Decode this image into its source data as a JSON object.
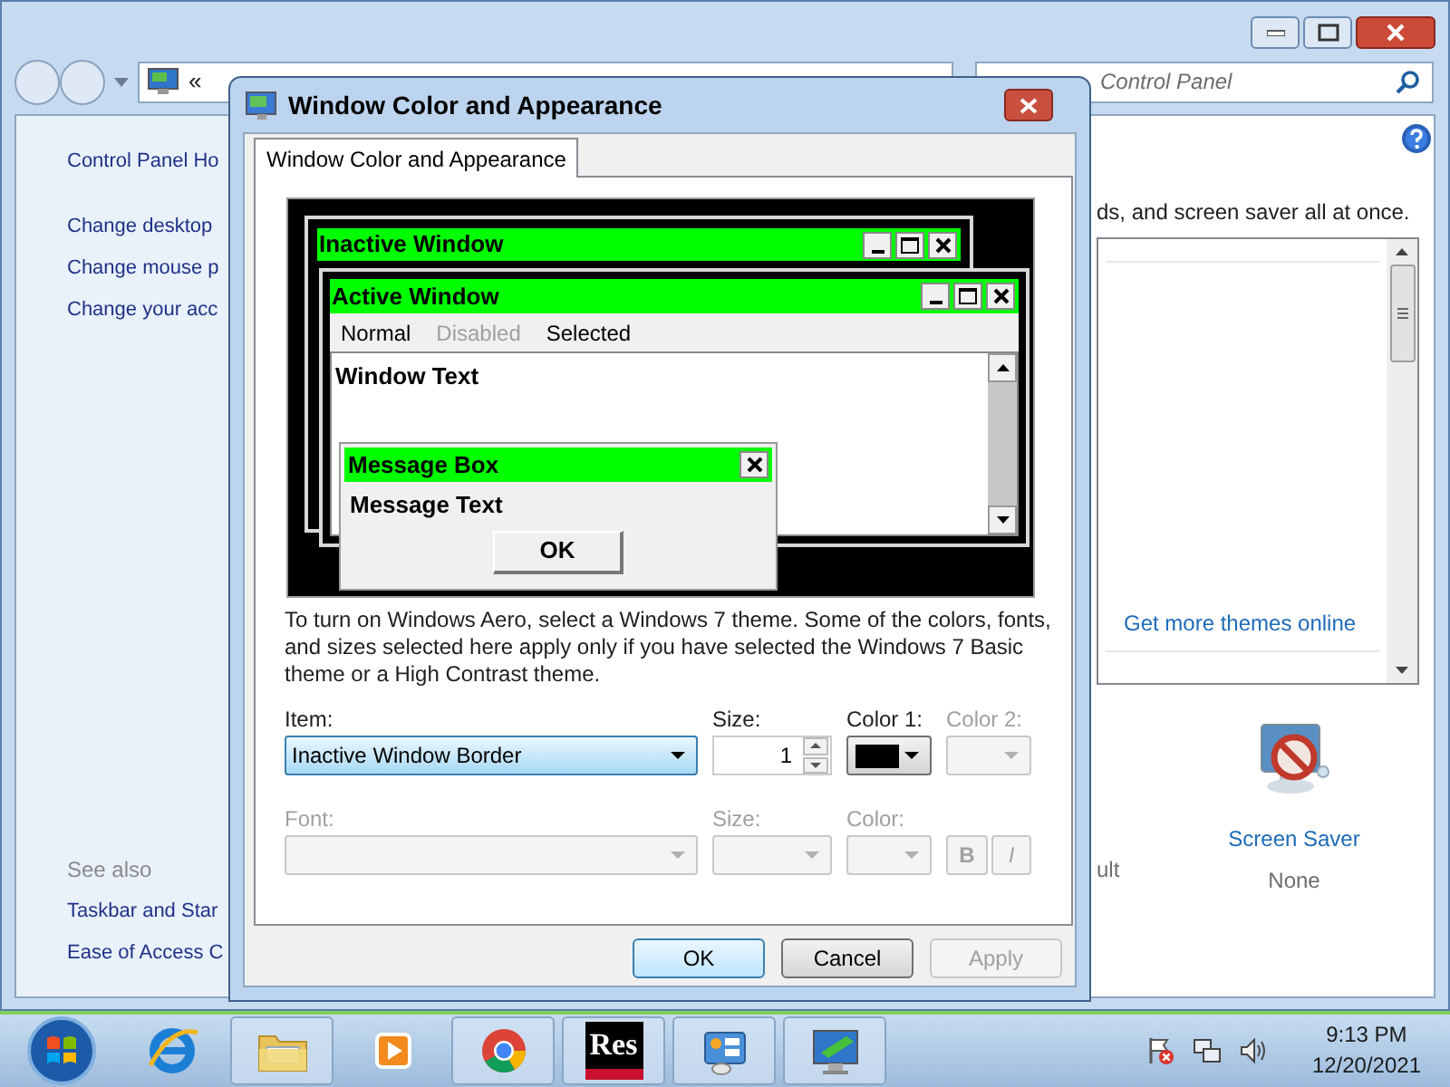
{
  "explorer": {
    "address_chevron": "«",
    "search_placeholder": "Control Panel",
    "nav_links": [
      "Control Panel Ho",
      "Change desktop",
      "Change mouse p",
      "Change your acc"
    ],
    "see_also_heading": "See also",
    "see_also_links": [
      "Taskbar and Star",
      "Ease of Access C"
    ],
    "intro_fragment": "ds, and screen saver all at once.",
    "themes_link": "Get more themes online",
    "cut_label": "ult",
    "screen_saver": {
      "label": "Screen Saver",
      "value": "None"
    }
  },
  "dialog": {
    "title": "Window Color and Appearance",
    "tabs": [
      {
        "label": "Window Color and Appearance",
        "selected": true
      }
    ],
    "preview": {
      "inactive_title": "Inactive Window",
      "active_title": "Active Window",
      "menu_items": [
        {
          "label": "Normal",
          "disabled": false
        },
        {
          "label": "Disabled",
          "disabled": true
        },
        {
          "label": "Selected",
          "disabled": false
        }
      ],
      "window_text": "Window Text",
      "message_title": "Message Box",
      "message_text": "Message Text",
      "ok_label": "OK"
    },
    "description": "To turn on Windows Aero, select a Windows 7 theme. Some of the colors, fonts, and sizes selected here apply only if you have selected the Windows 7 Basic theme or a High Contrast theme.",
    "item": {
      "label": "Item:",
      "value": "Inactive Window Border"
    },
    "size": {
      "label": "Size:",
      "value": "1"
    },
    "color1": {
      "label": "Color 1:",
      "color": "#000000"
    },
    "color2": {
      "label": "Color 2:",
      "disabled": true
    },
    "font_row": {
      "font_label": "Font:",
      "size_label": "Size:",
      "color_label": "Color:",
      "bold": "B",
      "italic": "I",
      "disabled": true
    },
    "buttons": [
      {
        "label": "OK",
        "kind": "default"
      },
      {
        "label": "Cancel",
        "kind": "normal"
      },
      {
        "label": "Apply",
        "kind": "disabled"
      }
    ]
  },
  "taskbar": {
    "apps": [
      {
        "kind": "ie",
        "running": false
      },
      {
        "kind": "folder",
        "running": true
      },
      {
        "kind": "media",
        "running": false
      },
      {
        "kind": "chrome",
        "running": true
      },
      {
        "kind": "res",
        "running": true,
        "label": "Res"
      },
      {
        "kind": "control",
        "running": true
      },
      {
        "kind": "display",
        "running": true
      }
    ],
    "time": "9:13 PM",
    "date": "12/20/2021"
  }
}
